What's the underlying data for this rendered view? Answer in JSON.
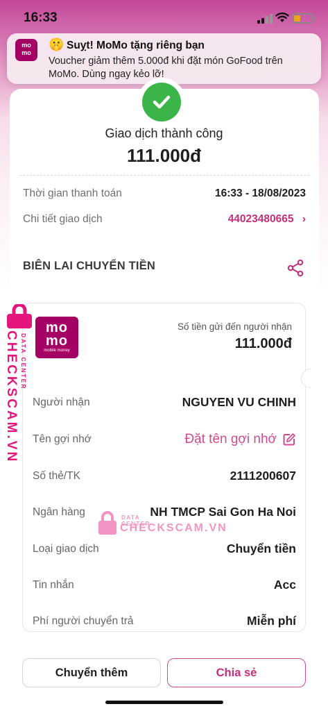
{
  "status_bar": {
    "time": "16:33",
    "icons": [
      "signal-icon",
      "wifi-icon",
      "battery-icon"
    ]
  },
  "notification": {
    "app_logo_text": "mo mo",
    "emoji": "🤫",
    "title": "Suỵt! MoMo tặng riêng bạn",
    "body": "Voucher giảm thêm 5.000đ khi đặt món GoFood trên MoMo. Dùng ngay kẻo lỡ!"
  },
  "transaction": {
    "status": "Giao dịch thành công",
    "amount": "111.000đ",
    "payment_time_label": "Thời gian thanh toán",
    "payment_time_value": "16:33 - 18/08/2023",
    "detail_label": "Chi tiết giao dịch",
    "detail_value": "44023480665"
  },
  "receipt": {
    "heading": "BIÊN LAI CHUYỂN TIỀN",
    "logo_line1": "mo",
    "logo_line2": "mo",
    "logo_tagline": "mobile money",
    "sent_label": "Số tiền gửi đến người nhận",
    "sent_amount": "111.000đ",
    "rows": [
      {
        "label": "Người nhận",
        "value": "NGUYEN VU CHINH"
      },
      {
        "label": "Tên gợi nhớ",
        "value": "Đặt tên gợi nhớ"
      },
      {
        "label": "Số thẻ/TK",
        "value": "2111200607"
      },
      {
        "label": "Ngân hàng",
        "value": "NH TMCP Sai Gon Ha Noi"
      },
      {
        "label": "Loại giao dịch",
        "value": "Chuyển tiền"
      },
      {
        "label": "Tin nhắn",
        "value": "Acc"
      },
      {
        "label": "Phí người chuyển trả",
        "value": "Miễn phí"
      }
    ]
  },
  "actions": {
    "transfer_more": "Chuyển thêm",
    "share": "Chia sẻ"
  },
  "watermark": {
    "brand": "CHECKSCAM.VN",
    "tag": "DATA CENTER"
  },
  "colors": {
    "brand_pink": "#c2307b",
    "momo_purple": "#a50064",
    "success_green": "#3bb54a"
  }
}
